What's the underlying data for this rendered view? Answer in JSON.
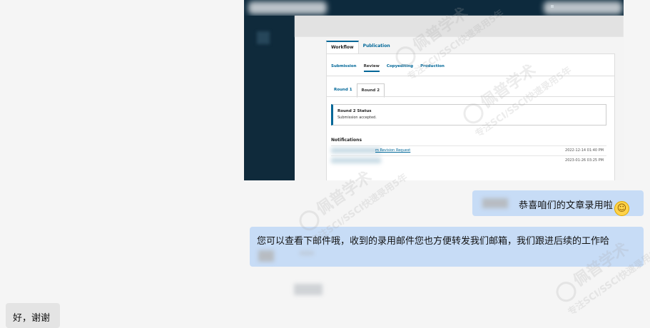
{
  "screenshot": {
    "workflow_tabs": [
      "Workflow",
      "Publication"
    ],
    "stage_tabs": [
      "Submission",
      "Review",
      "Copyediting",
      "Production"
    ],
    "round_tabs": [
      "Round 1",
      "Round 2"
    ],
    "status_title": "Round 2 Status",
    "status_text": "Submission accepted.",
    "notifications_title": "Notifications",
    "notifications": [
      {
        "link": "m Revision Request",
        "date": "2022-12-14 01:40 PM"
      },
      {
        "link": "",
        "date": "2023-01-26 03:25 PM"
      }
    ]
  },
  "chat": {
    "msg1": "恭喜咱们的文章录用啦",
    "msg1_emoji": "☺",
    "msg2": "您可以查看下邮件哦，收到的录用邮件您也方便转发我们邮箱，我们跟进后续的工作哈",
    "msg3": "好，谢谢"
  },
  "watermark": {
    "brand": "佩普学术",
    "tagline": "专注SCI/SSCI快速录用5年"
  }
}
